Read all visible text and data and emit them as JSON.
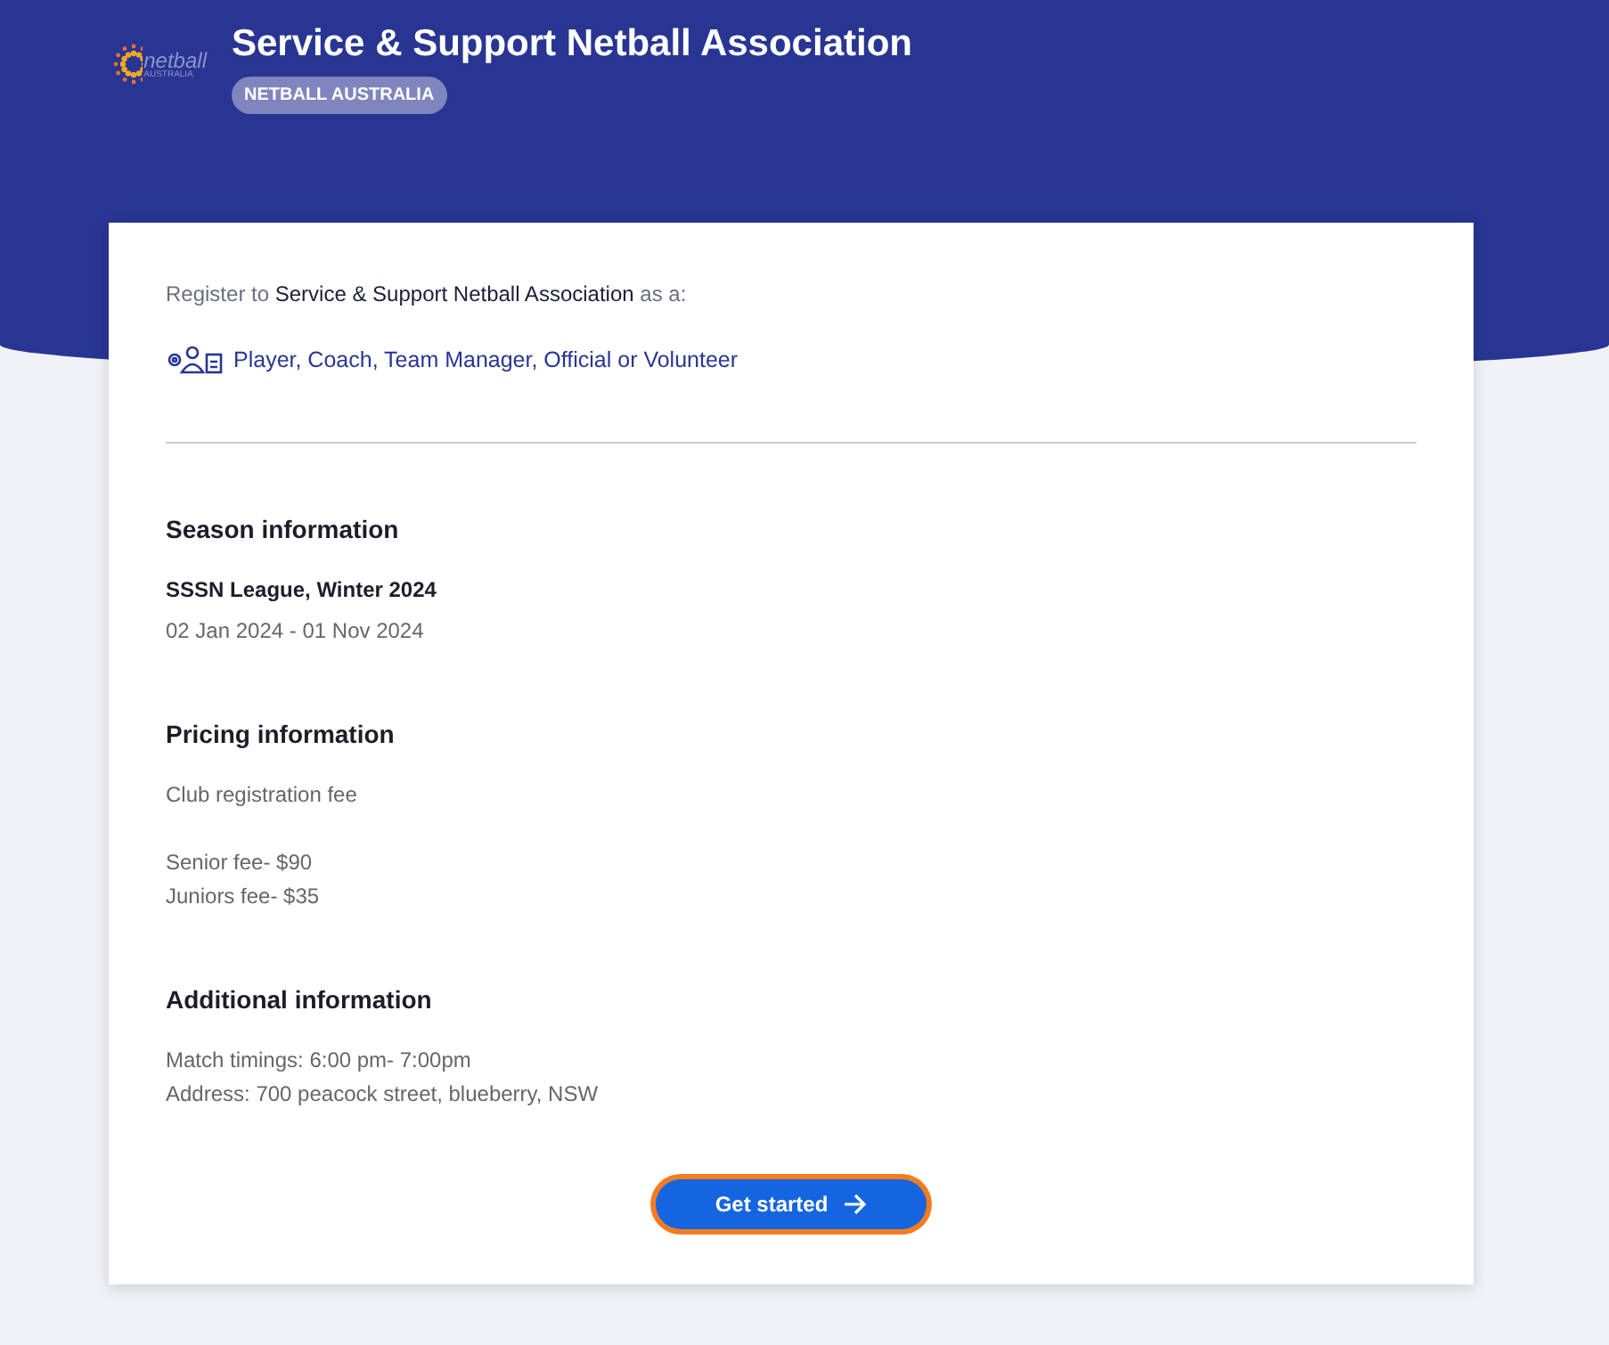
{
  "header": {
    "logo": {
      "word": "netball",
      "sub": "AUSTRALIA"
    },
    "title": "Service & Support Netball Association",
    "badge": "NETBALL AUSTRALIA"
  },
  "register": {
    "text": "Register to **Service & Support Netball Association** as a:",
    "roles": "Player, Coach, Team Manager, Official or Volunteer"
  },
  "sections": [
    {
      "heading": "Season information",
      "lines": [
        {
          "kind": "strong",
          "text": "SSSN League, Winter 2024"
        },
        {
          "kind": "plain",
          "text": "02 Jan 2024 - 01 Nov 2024"
        }
      ]
    },
    {
      "heading": "Pricing information",
      "lines": [
        {
          "kind": "plain",
          "text": "Club registration fee"
        },
        {
          "kind": "gap"
        },
        {
          "kind": "plain",
          "text": "Senior fee- $90"
        },
        {
          "kind": "plain",
          "text": "Juniors fee- $35"
        }
      ]
    },
    {
      "heading": "Additional information",
      "lines": [
        {
          "kind": "plain",
          "text": "Match timings: 6:00 pm- 7:00pm"
        },
        {
          "kind": "plain",
          "text": "Address: 700 peacock street, blueberry, NSW"
        }
      ]
    }
  ],
  "button": {
    "label": "Get started",
    "focused": true
  }
}
